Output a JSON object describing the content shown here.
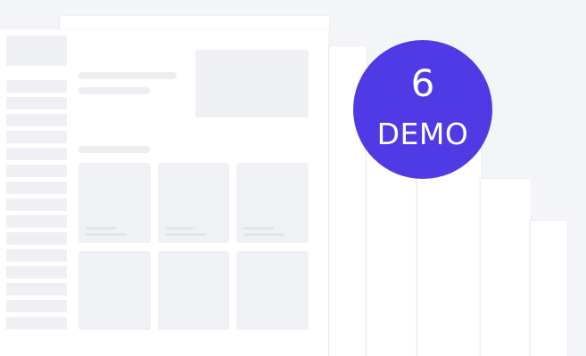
{
  "badge": {
    "number": "6",
    "label": "DEMO",
    "color": "#4f3ae6",
    "text_color": "#ffffff"
  },
  "colors": {
    "background": "#f4f5f8",
    "page": "#ffffff",
    "skeleton": "#eff0f3"
  },
  "sidebar": {
    "item_count": 15
  },
  "grid": {
    "card_count": 6
  }
}
